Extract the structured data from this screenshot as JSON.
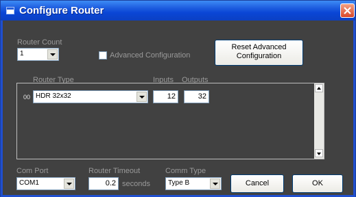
{
  "window": {
    "title": "Configure Router"
  },
  "router_count": {
    "label": "Router Count",
    "value": "1"
  },
  "advanced": {
    "label": "Advanced Configuration",
    "checked": false
  },
  "reset_button": {
    "line1": "Reset Advanced",
    "line2": "Configuration"
  },
  "table": {
    "headers": {
      "router_type": "Router Type",
      "inputs": "Inputs",
      "outputs": "Outputs"
    },
    "rows": [
      {
        "index": "00",
        "router_type": "HDR 32x32",
        "inputs": "12",
        "outputs": "32"
      }
    ]
  },
  "com_port": {
    "label": "Com Port",
    "value": "COM1"
  },
  "router_timeout": {
    "label": "Router Timeout",
    "value": "0.2",
    "unit": "seconds"
  },
  "comm_type": {
    "label": "Comm Type",
    "value": "Type B"
  },
  "buttons": {
    "cancel": "Cancel",
    "ok": "OK"
  },
  "colors": {
    "titlebar": "#0a46d6",
    "background": "#414141",
    "close": "#d8472a"
  }
}
